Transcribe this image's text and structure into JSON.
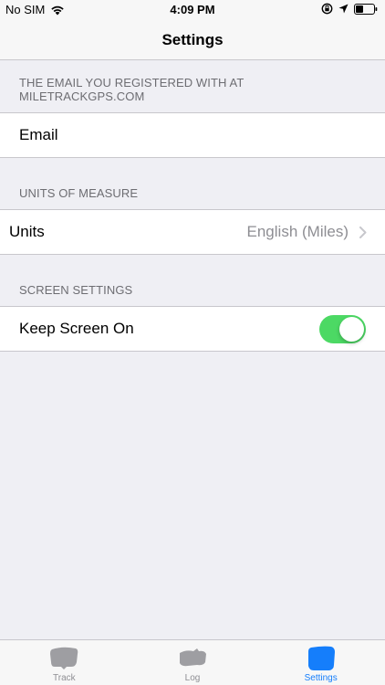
{
  "status_bar": {
    "carrier": "No SIM",
    "time": "4:09 PM"
  },
  "nav": {
    "title": "Settings"
  },
  "sections": [
    {
      "header": "THE EMAIL YOU REGISTERED WITH AT MILETRACKGPS.COM",
      "label": "Email"
    },
    {
      "header": "UNITS OF MEASURE",
      "label": "Units",
      "value": "English (Miles)"
    },
    {
      "header": "SCREEN SETTINGS",
      "label": "Keep Screen On",
      "toggle_on": true
    }
  ],
  "tabs": [
    {
      "label": "Track",
      "icon": "track-icon",
      "active": false
    },
    {
      "label": "Log",
      "icon": "log-icon",
      "active": false
    },
    {
      "label": "Settings",
      "icon": "settings-icon",
      "active": true
    }
  ],
  "colors": {
    "accent": "#157efb",
    "toggle_on": "#4cd964",
    "background": "#efeff4",
    "secondary_text": "#6d6d72"
  }
}
